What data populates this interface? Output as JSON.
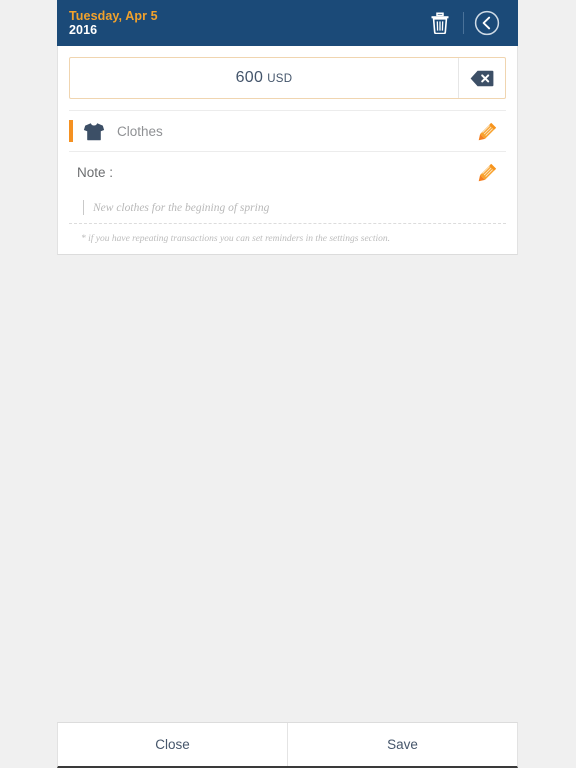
{
  "header": {
    "date": "Tuesday, Apr 5",
    "year": "2016",
    "delete_icon": "trash-icon",
    "back_icon": "chevron-left-circle-icon",
    "bg_color": "#1b4a78",
    "date_color": "#f2a22c"
  },
  "amount": {
    "value": "600",
    "currency": "USD",
    "clear_icon": "backspace-icon",
    "border_color": "#f0d5b0"
  },
  "category": {
    "label": "Clothes",
    "icon": "tshirt-icon",
    "accent_color": "#f59121",
    "edit_icon": "pencil-icon"
  },
  "note": {
    "label": "Note :",
    "placeholder": "New clothes for the begining of spring",
    "value": "",
    "edit_icon": "pencil-icon"
  },
  "hint": {
    "text": "* if you have repeating transactions you can set reminders in the settings section."
  },
  "footer": {
    "close_label": "Close",
    "save_label": "Save"
  }
}
